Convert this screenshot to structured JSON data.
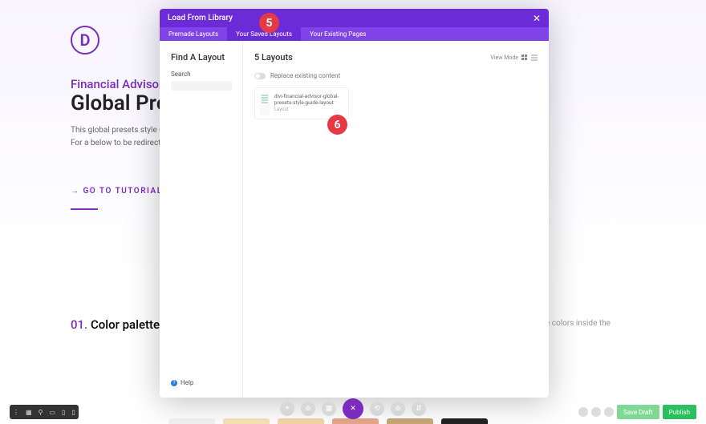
{
  "page": {
    "logo_letter": "D",
    "heading_small": "Financial Advisor Layo",
    "heading_large": "Global Prese",
    "paragraph": "This global presets style guide is a modules into global presets? For a below to be redirected.",
    "go_link": "→ GO TO TUTORIAL",
    "color_section_num": "01.",
    "color_section_text": "Color palette",
    "right_text_fragment": "e colors inside the"
  },
  "modal": {
    "title": "Load From Library",
    "close": "✕",
    "tabs": {
      "premade": "Premade Layouts",
      "saved": "Your Saved Layouts",
      "existing": "Your Existing Pages"
    },
    "left": {
      "find": "Find A Layout",
      "search_label": "Search",
      "help": "Help"
    },
    "right": {
      "title": "5 Layouts",
      "view_mode": "View Mode",
      "replace": "Replace existing content",
      "card_name": "divi-financial-advisor-global-presets-style-guide-layout",
      "card_sub": "Layout"
    }
  },
  "callouts": {
    "five": "5",
    "six": "6"
  },
  "bottom": {
    "save_draft": "Save Draft",
    "publish": "Publish"
  },
  "swatches": [
    "#f3f3f3",
    "#f5e6b8",
    "#f5d6a8",
    "#e8a88a",
    "#c9a878",
    "#222222"
  ]
}
